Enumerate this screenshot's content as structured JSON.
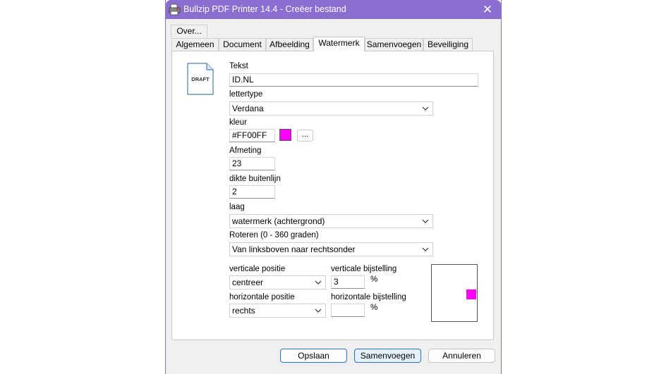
{
  "window": {
    "title": "Bullzip PDF Printer 14.4 - Creëer bestand",
    "close_glyph": "✕",
    "accent_color": "#8a6fd1"
  },
  "tabs": {
    "row1": [
      {
        "label": "Over..."
      }
    ],
    "row2": [
      {
        "label": "Algemeen"
      },
      {
        "label": "Document"
      },
      {
        "label": "Afbeelding"
      },
      {
        "label": "Watermerk",
        "active": true
      },
      {
        "label": "Samenvoegen"
      },
      {
        "label": "Beveiliging"
      }
    ]
  },
  "watermark": {
    "draft_icon_text": "DRAFT",
    "text_label": "Tekst",
    "text_value": "ID.NL",
    "font_label": "lettertype",
    "font_value": "Verdana",
    "color_label": "kleur",
    "color_value": "#FF00FF",
    "color_swatch": "#ff00ff",
    "color_button": "...",
    "size_label": "Afmeting",
    "size_value": "23",
    "outline_label": "dikte buitenlijn",
    "outline_value": "2",
    "layer_label": "laag",
    "layer_value": "watermerk (achtergrond)",
    "rotate_label": "Roteren (0 - 360 graden)",
    "rotate_value": "Van linksboven naar rechtsonder",
    "vpos_label": "verticale positie",
    "vpos_value": "centreer",
    "vadj_label": "verticale bijstelling",
    "vadj_value": "3",
    "vadj_unit": "%",
    "hpos_label": "horizontale positie",
    "hpos_value": "rechts",
    "hadj_label": "horizontale bijstelling",
    "hadj_value": "",
    "hadj_unit": "%"
  },
  "buttons": {
    "save": "Opslaan",
    "merge": "Samenvoegen",
    "cancel": "Annuleren"
  }
}
